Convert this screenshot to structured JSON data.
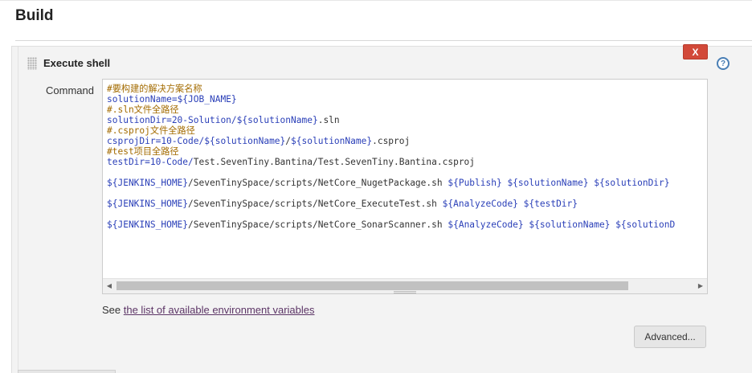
{
  "section": {
    "title": "Build"
  },
  "step": {
    "title": "Execute shell",
    "delete_label": "X",
    "help_label": "?"
  },
  "command": {
    "label": "Command",
    "lines": [
      [
        {
          "t": "#要构建的解决方案名称",
          "c": "comment"
        }
      ],
      [
        {
          "t": "solutionName=",
          "c": "var"
        },
        {
          "t": "${JOB_NAME}",
          "c": "var"
        }
      ],
      [
        {
          "t": "#.sln文件全路径",
          "c": "comment"
        }
      ],
      [
        {
          "t": "solutionDir=20-Solution/",
          "c": "var"
        },
        {
          "t": "${solutionName}",
          "c": "var"
        },
        {
          "t": ".sln",
          "c": "text"
        }
      ],
      [
        {
          "t": "#.csproj文件全路径",
          "c": "comment"
        }
      ],
      [
        {
          "t": "csprojDir=10-Code/",
          "c": "var"
        },
        {
          "t": "${solutionName}",
          "c": "var"
        },
        {
          "t": "/",
          "c": "text"
        },
        {
          "t": "${solutionName}",
          "c": "var"
        },
        {
          "t": ".csproj",
          "c": "text"
        }
      ],
      [
        {
          "t": "#test项目全路径",
          "c": "comment"
        }
      ],
      [
        {
          "t": "testDir=10-Code/",
          "c": "var"
        },
        {
          "t": "Test.SevenTiny.Bantina/Test.SevenTiny.Bantina.csproj",
          "c": "text"
        }
      ],
      [],
      [
        {
          "t": "${JENKINS_HOME}",
          "c": "var"
        },
        {
          "t": "/SevenTinySpace/scripts/NetCore_NugetPackage.sh ",
          "c": "text"
        },
        {
          "t": "${Publish} ${solutionName} ${solutionDir}",
          "c": "var"
        }
      ],
      [],
      [
        {
          "t": "${JENKINS_HOME}",
          "c": "var"
        },
        {
          "t": "/SevenTinySpace/scripts/NetCore_ExecuteTest.sh ",
          "c": "text"
        },
        {
          "t": "${AnalyzeCode} ${testDir}",
          "c": "var"
        }
      ],
      [],
      [
        {
          "t": "${JENKINS_HOME}",
          "c": "var"
        },
        {
          "t": "/SevenTinySpace/scripts/NetCore_SonarScanner.sh ",
          "c": "text"
        },
        {
          "t": "${AnalyzeCode} ${solutionName} ${solutionD",
          "c": "var"
        }
      ]
    ]
  },
  "env": {
    "prefix": "See ",
    "link_label": "the list of available environment variables"
  },
  "advanced_label": "Advanced...",
  "colors": {
    "comment": "#a36b00",
    "variable": "#2a3fb8",
    "delete_button": "#d24939",
    "link": "#5c3566"
  }
}
